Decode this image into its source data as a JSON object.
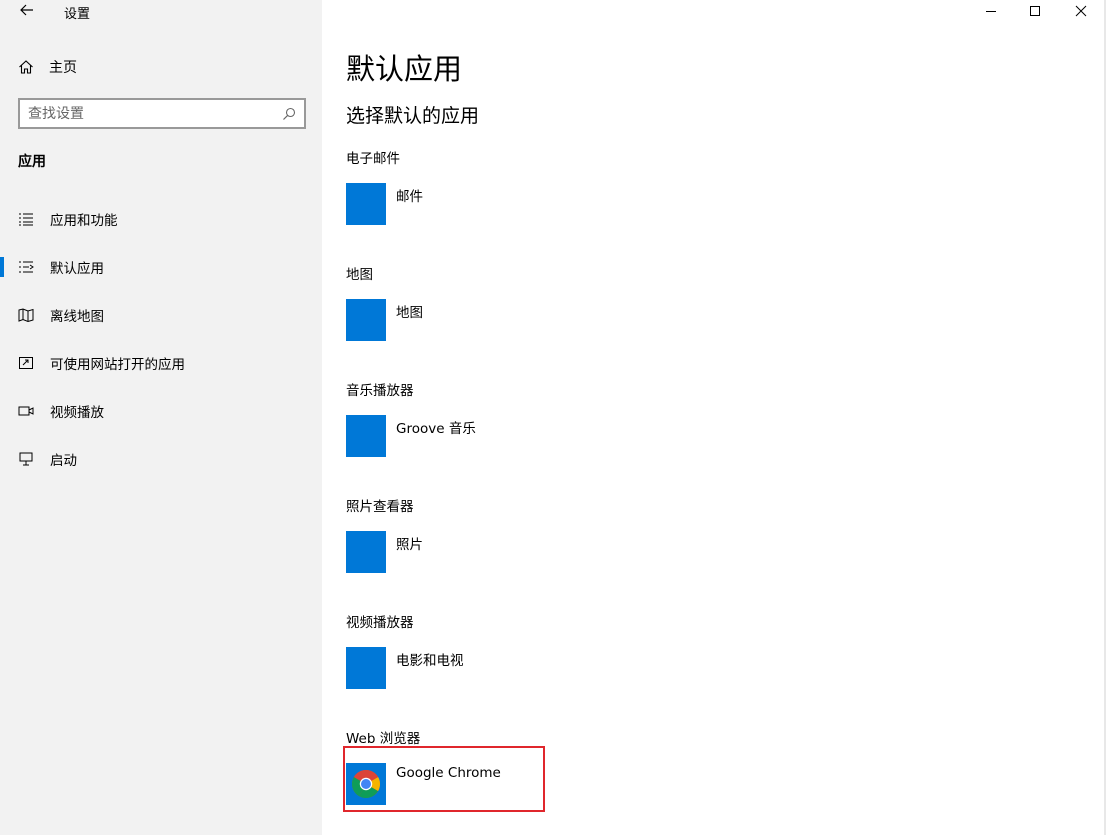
{
  "window": {
    "title": "设置"
  },
  "sidebar": {
    "home_label": "主页",
    "search_placeholder": "查找设置",
    "section_title": "应用",
    "items": [
      {
        "label": "应用和功能",
        "icon": "list-icon"
      },
      {
        "label": "默认应用",
        "icon": "default-apps-icon",
        "selected": true
      },
      {
        "label": "离线地图",
        "icon": "map-icon"
      },
      {
        "label": "可使用网站打开的应用",
        "icon": "open-external-icon"
      },
      {
        "label": "视频播放",
        "icon": "video-icon"
      },
      {
        "label": "启动",
        "icon": "startup-icon"
      }
    ]
  },
  "main": {
    "title": "默认应用",
    "subtitle": "选择默认的应用",
    "categories": [
      {
        "label": "电子邮件",
        "app": "邮件"
      },
      {
        "label": "地图",
        "app": "地图"
      },
      {
        "label": "音乐播放器",
        "app": "Groove 音乐"
      },
      {
        "label": "照片查看器",
        "app": "照片"
      },
      {
        "label": "视频播放器",
        "app": "电影和电视"
      },
      {
        "label": "Web 浏览器",
        "app": "Google Chrome",
        "highlighted": true
      }
    ]
  },
  "colors": {
    "accent": "#0078d7",
    "sidebar_bg": "#f2f2f2",
    "highlight_border": "#e0262c"
  }
}
